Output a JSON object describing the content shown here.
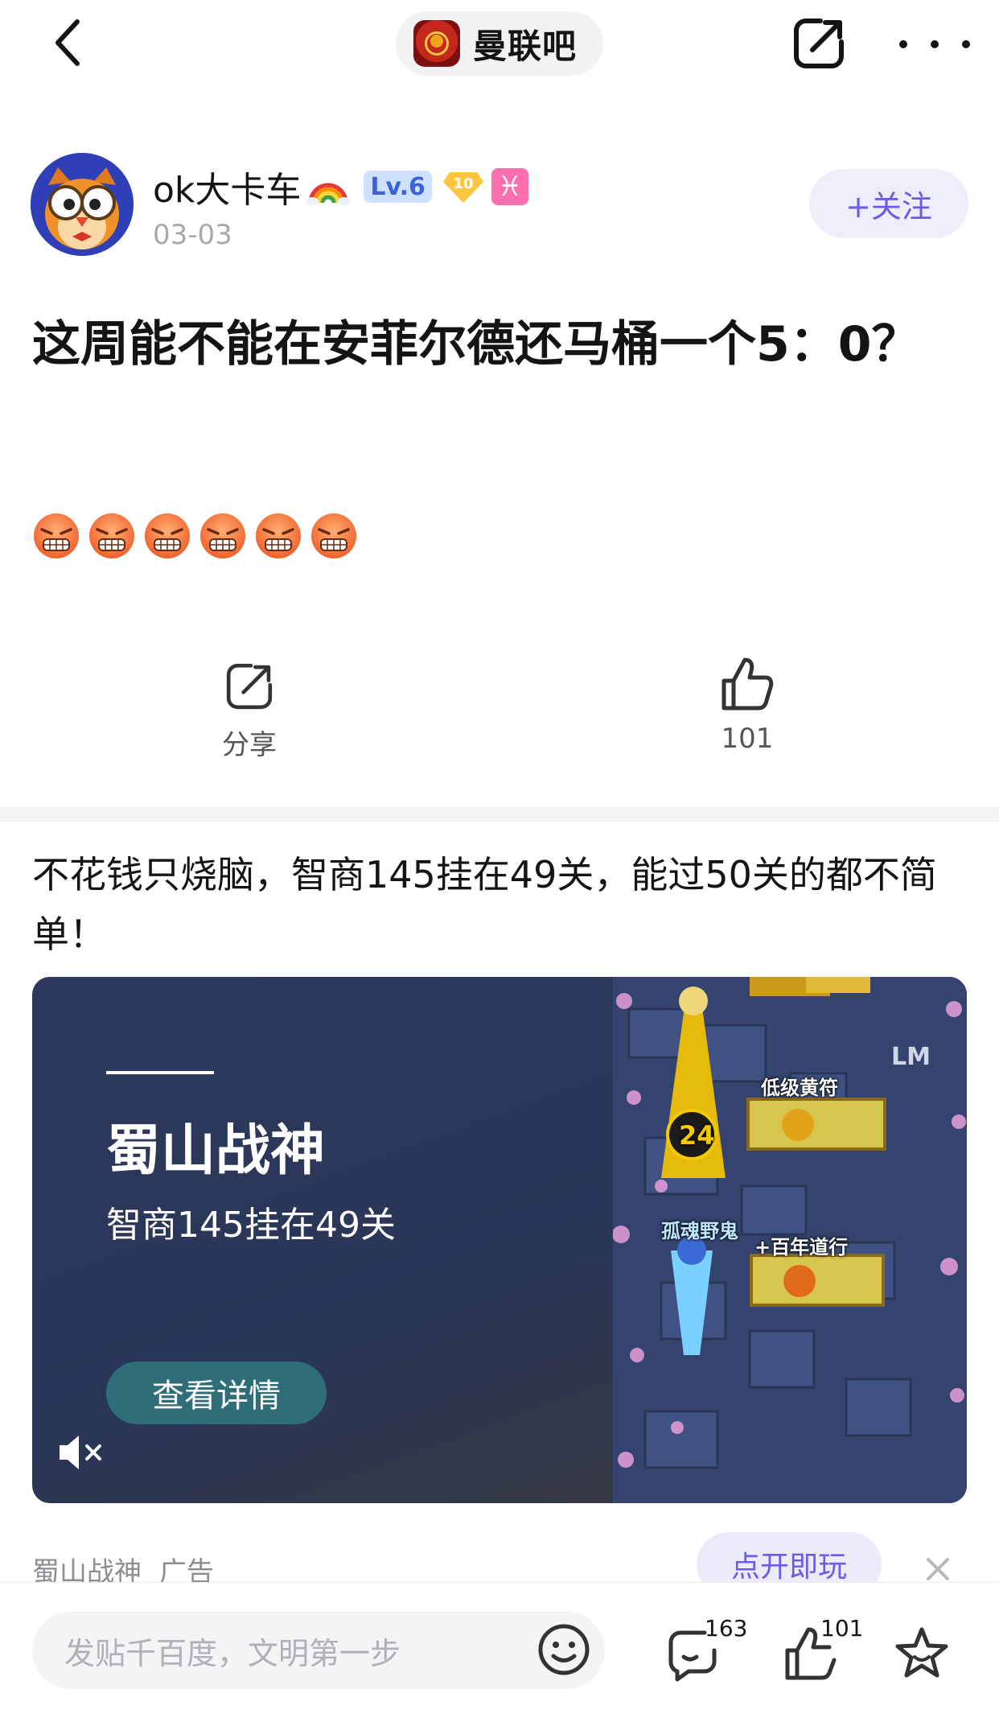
{
  "nav": {
    "forum_name": "曼联吧",
    "back_icon": "chevron-left-icon",
    "share_icon": "share-icon",
    "more_icon": "more-icon"
  },
  "author": {
    "name": "ok大卡车",
    "level": "Lv.6",
    "fan_level": "10",
    "zodiac": "♓",
    "date": "03-03",
    "follow_label": "+关注"
  },
  "post": {
    "title": "这周能不能在安菲尔德还马桶一个5：0？",
    "emoji_count": 6
  },
  "actions": {
    "share_label": "分享",
    "like_count": "101"
  },
  "ad": {
    "headline": "不花钱只烧脑，智商145挂在49关，能过50关的都不简单！",
    "game_title": "蜀山战神",
    "game_subtitle": "智商145挂在49关",
    "detail_button": "查看详情",
    "art_labels": {
      "level": "24",
      "watermark": "LM",
      "item1": "低级黄符",
      "enemy": "孤魂野鬼",
      "item2": "+百年道行"
    },
    "source": "蜀山战神",
    "tag": "广告",
    "play_button": "点开即玩"
  },
  "bottom_bar": {
    "input_placeholder": "发贴千百度，文明第一步",
    "comment_count": "163",
    "like_count": "101"
  },
  "colors": {
    "accent": "#6b5ce7",
    "follow_bg": "#eeeefb",
    "ad_button": "#2f6e78",
    "divider": "#f4f4f7"
  }
}
